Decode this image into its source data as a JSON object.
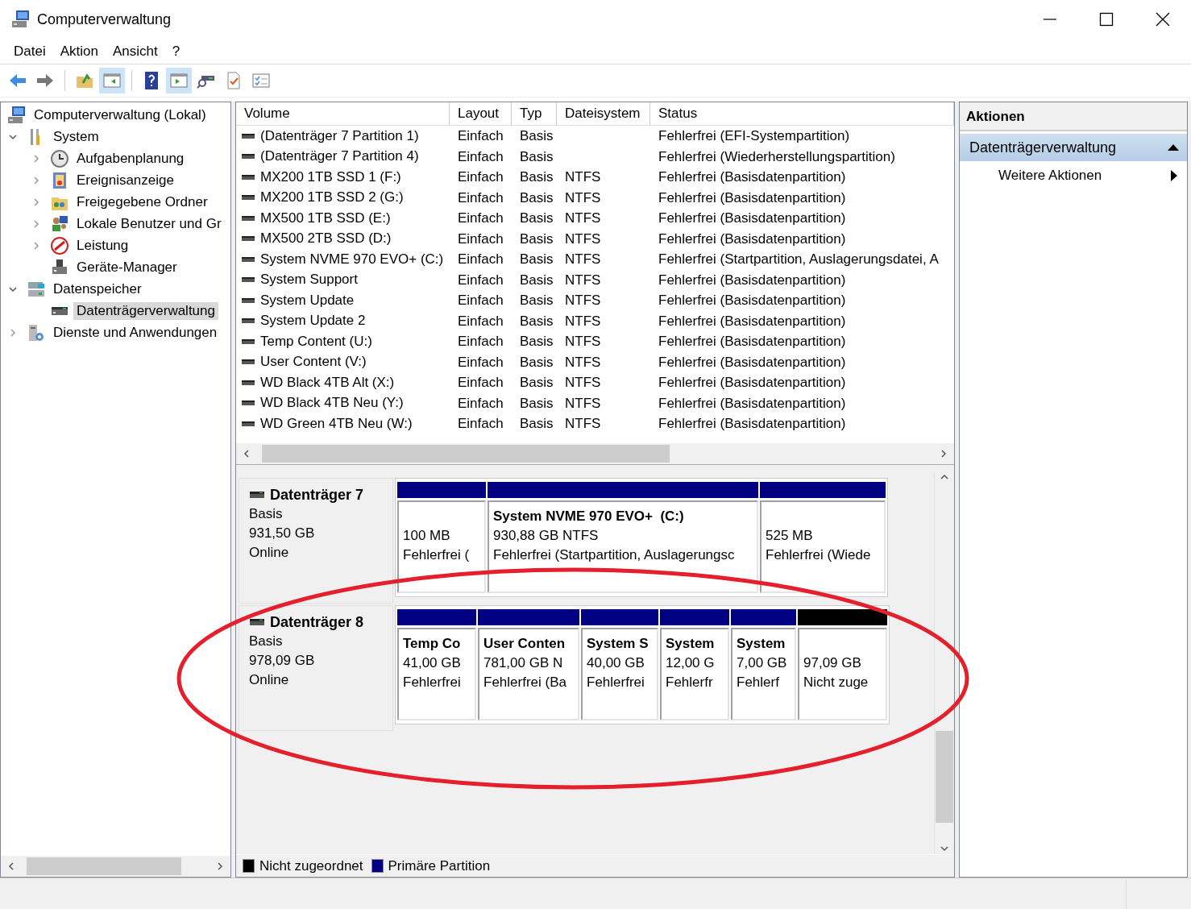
{
  "window": {
    "title": "Computerverwaltung"
  },
  "menu": [
    "Datei",
    "Aktion",
    "Ansicht",
    "?"
  ],
  "toolbar": [
    {
      "kind": "back",
      "pressed": false
    },
    {
      "kind": "forward",
      "pressed": false
    },
    {
      "kind": "folder-up",
      "pressed": false
    },
    {
      "kind": "tree-pane",
      "pressed": true
    },
    {
      "kind": "help",
      "pressed": false
    },
    {
      "kind": "action-pane",
      "pressed": true
    },
    {
      "kind": "scope",
      "pressed": false
    },
    {
      "kind": "properties",
      "pressed": false
    },
    {
      "kind": "list",
      "pressed": false
    }
  ],
  "tree": [
    {
      "label": "Computerverwaltung (Lokal)",
      "kind": "computer",
      "selected": false,
      "children": [
        {
          "label": "System",
          "kind": "tools",
          "expanded": true,
          "selected": false,
          "children": [
            {
              "label": "Aufgabenplanung",
              "kind": "clock",
              "expanded": false,
              "selected": false
            },
            {
              "label": "Ereignisanzeige",
              "kind": "eventlog",
              "expanded": false,
              "selected": false
            },
            {
              "label": "Freigegebene Ordner",
              "kind": "shared",
              "expanded": false,
              "selected": false
            },
            {
              "label": "Lokale Benutzer und Gr",
              "kind": "users",
              "expanded": false,
              "selected": false
            },
            {
              "label": "Leistung",
              "kind": "performance",
              "expanded": false,
              "selected": false
            },
            {
              "label": "Geräte-Manager",
              "kind": "device",
              "selected": false
            }
          ]
        },
        {
          "label": "Datenspeicher",
          "kind": "storage",
          "expanded": true,
          "selected": false,
          "children": [
            {
              "label": "Datenträgerverwaltung",
              "kind": "disk",
              "selected": true
            }
          ]
        },
        {
          "label": "Dienste und Anwendungen",
          "kind": "services",
          "expanded": false,
          "selected": false
        }
      ]
    }
  ],
  "table": {
    "columns": [
      "Volume",
      "Layout",
      "Typ",
      "Dateisystem",
      "Status"
    ],
    "rows": [
      [
        "(Datenträger 7 Partition 1)",
        "Einfach",
        "Basis",
        "",
        "Fehlerfrei (EFI-Systempartition)"
      ],
      [
        "(Datenträger 7 Partition 4)",
        "Einfach",
        "Basis",
        "",
        "Fehlerfrei (Wiederherstellungspartition)"
      ],
      [
        "MX200 1TB SSD 1 (F:)",
        "Einfach",
        "Basis",
        "NTFS",
        "Fehlerfrei (Basisdatenpartition)"
      ],
      [
        "MX200 1TB SSD 2 (G:)",
        "Einfach",
        "Basis",
        "NTFS",
        "Fehlerfrei (Basisdatenpartition)"
      ],
      [
        "MX500 1TB SSD (E:)",
        "Einfach",
        "Basis",
        "NTFS",
        "Fehlerfrei (Basisdatenpartition)"
      ],
      [
        "MX500 2TB SSD (D:)",
        "Einfach",
        "Basis",
        "NTFS",
        "Fehlerfrei (Basisdatenpartition)"
      ],
      [
        "System NVME 970 EVO+ (C:)",
        "Einfach",
        "Basis",
        "NTFS",
        "Fehlerfrei (Startpartition, Auslagerungsdatei, A"
      ],
      [
        "System Support",
        "Einfach",
        "Basis",
        "NTFS",
        "Fehlerfrei (Basisdatenpartition)"
      ],
      [
        "System Update",
        "Einfach",
        "Basis",
        "NTFS",
        "Fehlerfrei (Basisdatenpartition)"
      ],
      [
        "System Update 2",
        "Einfach",
        "Basis",
        "NTFS",
        "Fehlerfrei (Basisdatenpartition)"
      ],
      [
        "Temp Content (U:)",
        "Einfach",
        "Basis",
        "NTFS",
        "Fehlerfrei (Basisdatenpartition)"
      ],
      [
        "User Content (V:)",
        "Einfach",
        "Basis",
        "NTFS",
        "Fehlerfrei (Basisdatenpartition)"
      ],
      [
        "WD Black 4TB Alt (X:)",
        "Einfach",
        "Basis",
        "NTFS",
        "Fehlerfrei (Basisdatenpartition)"
      ],
      [
        "WD Black 4TB Neu (Y:)",
        "Einfach",
        "Basis",
        "NTFS",
        "Fehlerfrei (Basisdatenpartition)"
      ],
      [
        "WD Green 4TB Neu (W:)",
        "Einfach",
        "Basis",
        "NTFS",
        "Fehlerfrei (Basisdatenpartition)"
      ]
    ]
  },
  "disks": [
    {
      "name": "Datenträger 7",
      "type": "Basis",
      "size": "931,50 GB",
      "status": "Online",
      "partitions": [
        {
          "kind": "primary",
          "size": "100 MB",
          "status": "Fehlerfrei ("
        },
        {
          "kind": "primary",
          "name": "System NVME 970 EVO+  (C:)",
          "size": "930,88 GB NTFS",
          "status": "Fehlerfrei (Startpartition, Auslagerungsc"
        },
        {
          "kind": "primary",
          "size": "525 MB",
          "status": "Fehlerfrei (Wiede"
        }
      ]
    },
    {
      "name": "Datenträger 8",
      "type": "Basis",
      "size": "978,09 GB",
      "status": "Online",
      "partitions": [
        {
          "kind": "primary",
          "name": "Temp Co",
          "size": "41,00 GB",
          "status": "Fehlerfrei"
        },
        {
          "kind": "primary",
          "name": "User Conten",
          "size": "781,00 GB N",
          "status": "Fehlerfrei (Ba"
        },
        {
          "kind": "primary",
          "name": "System S",
          "size": "40,00 GB",
          "status": "Fehlerfrei"
        },
        {
          "kind": "primary",
          "name": "System",
          "size": "12,00 G",
          "status": "Fehlerfr"
        },
        {
          "kind": "primary",
          "name": "System",
          "size": "7,00 GB",
          "status": "Fehlerf"
        },
        {
          "kind": "unallocated",
          "size": "97,09 GB",
          "status": "Nicht zuge"
        }
      ]
    }
  ],
  "legend": [
    {
      "label": "Nicht zugeordnet",
      "color": "#000000"
    },
    {
      "label": "Primäre Partition",
      "color": "#000080"
    }
  ],
  "actions": {
    "title": "Aktionen",
    "section": {
      "label": "Datenträgerverwaltung",
      "expanded": true
    },
    "items": [
      "Weitere Aktionen"
    ]
  }
}
